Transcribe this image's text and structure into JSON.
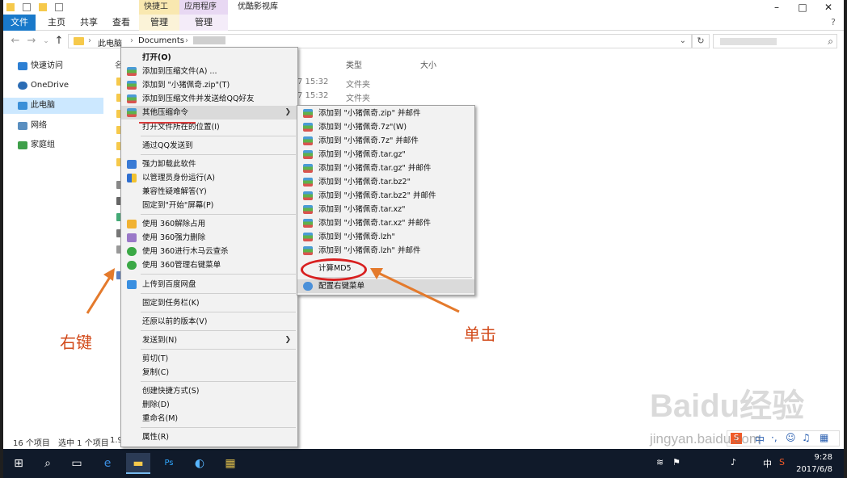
{
  "window": {
    "title": "优酷影视库",
    "context_tabs": [
      "快捷工具",
      "应用程序工具"
    ],
    "context_subtabs": [
      "管理",
      "管理"
    ]
  },
  "ribbon": {
    "tabs": [
      "文件",
      "主页",
      "共享",
      "查看"
    ]
  },
  "address": {
    "crumbs": [
      "此电脑",
      "Documents"
    ]
  },
  "nav": {
    "items": [
      "快速访问",
      "OneDrive",
      "此电脑",
      "网络",
      "家庭组"
    ]
  },
  "content": {
    "col_name": "名",
    "col_type": "类型",
    "col_size": "大小",
    "rows": [
      {
        "date": "7 15:32",
        "type": "文件夹"
      },
      {
        "date": "7 15:32",
        "type": "文件夹"
      }
    ]
  },
  "status": {
    "count": "16 个项目",
    "selected": "选中 1 个项目",
    "size": "1.9"
  },
  "main_menu": {
    "items": [
      "打开(O)",
      "添加到压缩文件(A) ...",
      "添加到 \"小猪佩奇.zip\"(T)",
      "添加到压缩文件并发送给QQ好友",
      "其他压缩命令",
      "打开文件所在的位置(I)",
      "通过QQ发送到",
      "强力卸载此软件",
      "以管理员身份运行(A)",
      "兼容性疑难解答(Y)",
      "固定到\"开始\"屏幕(P)",
      "使用 360解除占用",
      "使用 360强力删除",
      "使用 360进行木马云查杀",
      "使用 360管理右键菜单",
      "上传到百度网盘",
      "固定到任务栏(K)",
      "还原以前的版本(V)",
      "发送到(N)",
      "剪切(T)",
      "复制(C)",
      "创建快捷方式(S)",
      "删除(D)",
      "重命名(M)",
      "属性(R)"
    ]
  },
  "sub_menu": {
    "items": [
      "添加到 \"小猪佩奇.zip\" 并邮件",
      "添加到 \"小猪佩奇.7z\"(W)",
      "添加到 \"小猪佩奇.7z\" 并邮件",
      "添加到 \"小猪佩奇.tar.gz\"",
      "添加到 \"小猪佩奇.tar.gz\" 并邮件",
      "添加到 \"小猪佩奇.tar.bz2\"",
      "添加到 \"小猪佩奇.tar.bz2\" 并邮件",
      "添加到 \"小猪佩奇.tar.xz\"",
      "添加到 \"小猪佩奇.tar.xz\" 并邮件",
      "添加到 \"小猪佩奇.lzh\"",
      "添加到 \"小猪佩奇.lzh\" 并邮件",
      "计算MD5",
      "配置右键菜单"
    ]
  },
  "annotations": {
    "right_click": "右键",
    "single_click": "单击"
  },
  "watermark": {
    "main": "Baidu经验",
    "sub": "jingyan.baidu.com"
  },
  "tray": {
    "ime": "中",
    "ime2": "中",
    "time": "9:28",
    "date": "2017/6/8"
  },
  "colors": {
    "accent": "#1979ca",
    "annotation": "#d24a1a",
    "circle": "#d82020"
  }
}
